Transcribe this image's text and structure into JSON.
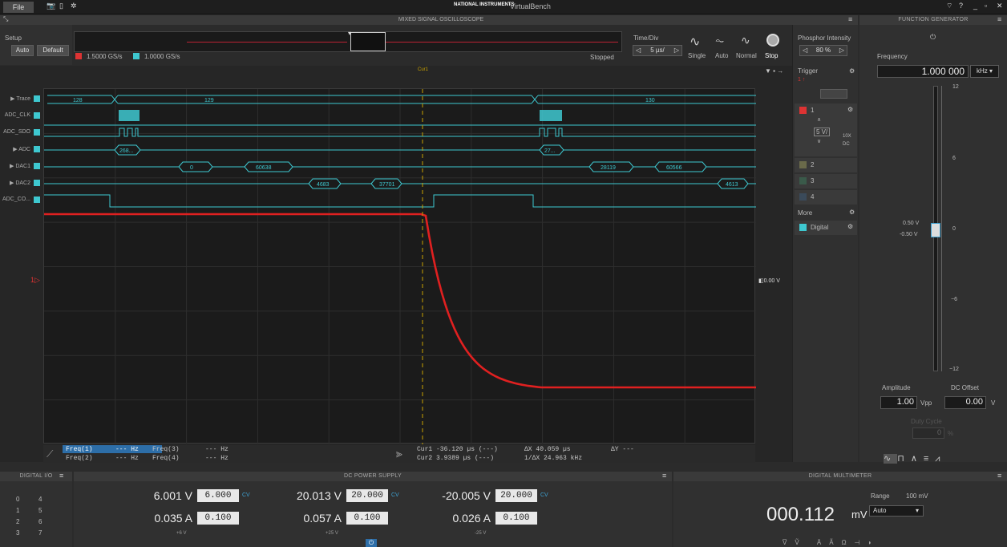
{
  "titlebar": {
    "file": "File",
    "app": "VirtualBench",
    "brand": "NATIONAL INSTRUMENTS"
  },
  "scope": {
    "title": "MIXED SIGNAL OSCILLOSCOPE",
    "setup": "Setup",
    "auto": "Auto",
    "default": "Default",
    "rate1": "1.5000 GS/s",
    "rate2": "1.0000 GS/s",
    "status": "Stopped",
    "time_div_label": "Time/Div",
    "time_div": "5 µs/",
    "modes": [
      "Single",
      "Auto",
      "Normal",
      "Stop"
    ],
    "phosphor_label": "Phosphor Intensity",
    "phosphor": "80 %",
    "trigger_label": "Trigger",
    "trigger_sub": "1 ↑",
    "ch1": "1",
    "ch1_scale": "5 V/",
    "ch1_probe": "10X",
    "ch1_coupling": "DC",
    "ch2": "2",
    "ch3": "3",
    "ch4": "4",
    "more": "More",
    "digital": "Digital",
    "trig_level": "0.00 V",
    "cur1_tag": "Cur1",
    "digital_rows": [
      "▶ Trace",
      "ADC_CLK",
      "ADC_SDO",
      "▶ ADC",
      "▶ DAC1",
      "▶ DAC2",
      "ADC_CO..."
    ],
    "bus_values": {
      "trace": [
        "128",
        "129",
        "130"
      ],
      "adc": [
        "268...",
        "27..."
      ],
      "dac1": [
        "0",
        "60638",
        "28119",
        "60566"
      ],
      "dac2": [
        "4683",
        "37701",
        "4613"
      ]
    },
    "freqs": [
      {
        "name": "Freq(1)",
        "val": "--- Hz"
      },
      {
        "name": "Freq(2)",
        "val": "--- Hz"
      },
      {
        "name": "Freq(3)",
        "val": "--- Hz"
      },
      {
        "name": "Freq(4)",
        "val": "--- Hz"
      }
    ],
    "cursors": {
      "cur1": "Cur1  -36.120 µs (---)",
      "cur2": "Cur2  3.9389 µs (---)",
      "dx": "ΔX  40.059 µs",
      "inv_dx": "1/ΔX  24.963 kHz",
      "dy": "ΔY  ---"
    }
  },
  "fgen": {
    "title": "FUNCTION GENERATOR",
    "freq_label": "Frequency",
    "freq": "1.000 000",
    "freq_unit": "kHz ▾",
    "scale": [
      "12",
      "6",
      "0",
      "−6",
      "−12"
    ],
    "offset_hi": "0.50 V",
    "offset_lo": "-0.50 V",
    "amp_label": "Amplitude",
    "amp": "1.00",
    "amp_unit": "Vpp",
    "dc_label": "DC Offset",
    "dc": "0.00",
    "dc_unit": "V",
    "duty_label": "Duty Cycle",
    "duty": "0",
    "duty_unit": "%"
  },
  "dio": {
    "title": "DIGITAL I/O",
    "pins": [
      "0",
      "4",
      "1",
      "5",
      "2",
      "6",
      "3",
      "7"
    ]
  },
  "power": {
    "title": "DC POWER SUPPLY",
    "ch": [
      {
        "v": "6.001 V",
        "vset": "6.000",
        "a": "0.035 A",
        "aset": "0.100",
        "name": "+6 V",
        "mode": "CV"
      },
      {
        "v": "20.013 V",
        "vset": "20.000",
        "a": "0.057 A",
        "aset": "0.100",
        "name": "+25 V",
        "mode": "CV"
      },
      {
        "v": "-20.005 V",
        "vset": "20.000",
        "a": "0.026 A",
        "aset": "0.100",
        "name": "-25 V",
        "mode": "CV"
      }
    ]
  },
  "dmm": {
    "title": "DIGITAL MULTIMETER",
    "value": "000.112",
    "unit": "mV",
    "range_label": "Range",
    "range_val": "100 mV",
    "range_sel": "Auto"
  }
}
